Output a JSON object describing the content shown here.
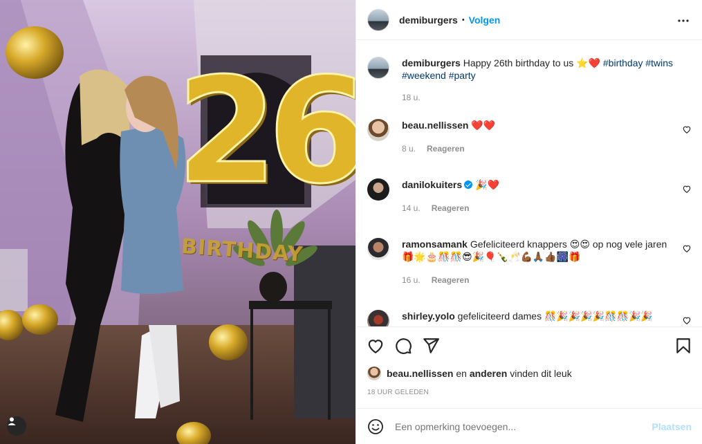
{
  "post": {
    "author": "demiburgers",
    "follow_label": "Volgen",
    "caption_text": "Happy 26th birthday to us ⭐❤️",
    "hashtags": [
      "#birthday",
      "#twins",
      "#weekend",
      "#party"
    ],
    "caption_time": "18 u."
  },
  "comments": [
    {
      "username": "beau.nellissen",
      "text": "❤️❤️",
      "time": "8 u.",
      "reply_label": "Reageren",
      "verified": false
    },
    {
      "username": "danilokuiters",
      "text": "🎉❤️",
      "time": "14 u.",
      "reply_label": "Reageren",
      "verified": true
    },
    {
      "username": "ramonsamank",
      "text": "Gefeliciteerd knappers 😍😍 op nog vele jaren 🎁🌟🎂🎊🎊😎🎉🎈🍾🥂💪🏾🙏🏾👍🏾🎆🎁",
      "time": "16 u.",
      "reply_label": "Reageren",
      "verified": false
    },
    {
      "username": "shirley.yolo",
      "text": "gefeliciteerd dames 🎊🎉🎉🎉🎉🎊🎊🎉🎉",
      "time": "",
      "reply_label": "",
      "verified": false
    }
  ],
  "likes": {
    "first_user": "beau.nellissen",
    "connector": "en",
    "others": "anderen",
    "suffix": "vinden dit leuk"
  },
  "timestamp": "18 uur geleden",
  "add_comment": {
    "placeholder": "Een opmerking toevoegen...",
    "post_label": "Plaatsen"
  },
  "photo": {
    "balloon_number": "26",
    "banner_text": "BIRTHDAY"
  },
  "icons": {
    "more": "more-horizontal-icon",
    "like": "heart-icon",
    "comment": "comment-icon",
    "share": "share-icon",
    "save": "bookmark-icon",
    "emoji": "emoji-icon",
    "user_tag": "user-tag-icon"
  },
  "colors": {
    "accent": "#0095f6",
    "hashtag": "#00376b",
    "muted": "#8e8e8e",
    "post_disabled": "#b2dffc",
    "gold": "#d4a526"
  }
}
